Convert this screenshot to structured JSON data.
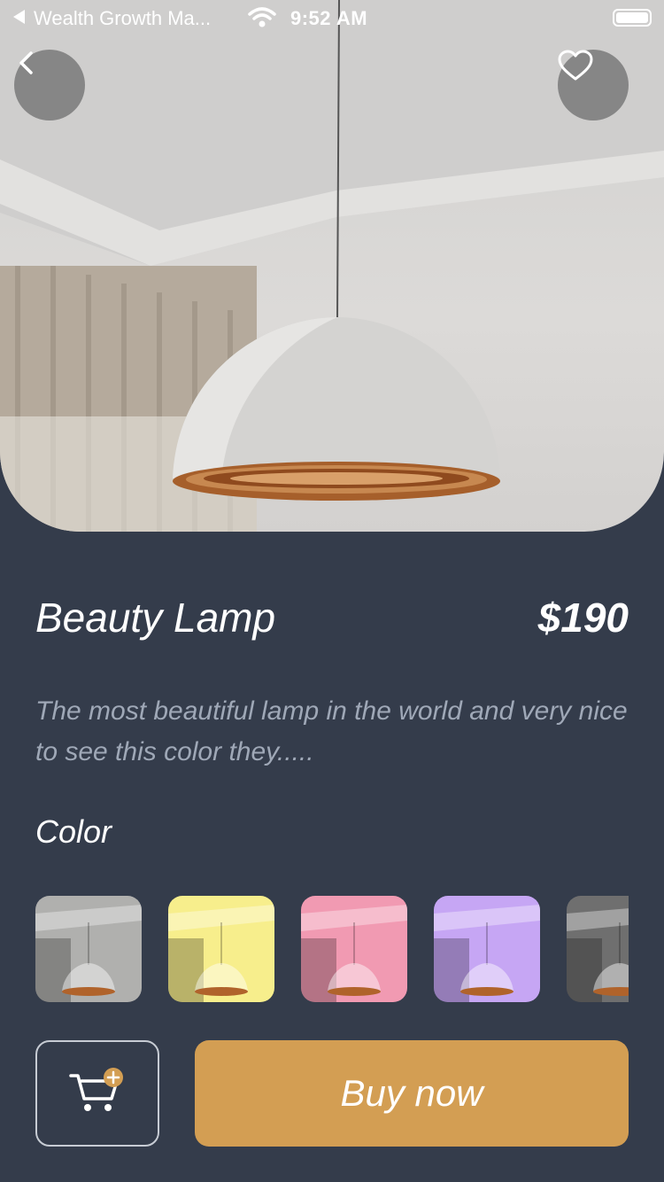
{
  "status_bar": {
    "back_app_label": "Wealth Growth Ma...",
    "time": "9:52 AM"
  },
  "product": {
    "title": "Beauty Lamp",
    "price": "$190",
    "description": "The most beautiful lamp in the world and very nice to see this color they.....",
    "color_label": "Color"
  },
  "swatches": [
    {
      "name": "white",
      "tint": "#b0b0ae"
    },
    {
      "name": "yellow",
      "tint": "#f7ee8c"
    },
    {
      "name": "pink",
      "tint": "#f19ab2"
    },
    {
      "name": "purple",
      "tint": "#c6a6f4"
    },
    {
      "name": "dark",
      "tint": "#6f6f6f"
    }
  ],
  "actions": {
    "buy_label": "Buy now"
  },
  "icons": {
    "back": "chevron-left-icon",
    "favorite": "heart-icon",
    "cart": "cart-add-icon"
  },
  "colors": {
    "background": "#343c4b",
    "accent": "#d39e53",
    "description_text": "#9fa8b7"
  }
}
